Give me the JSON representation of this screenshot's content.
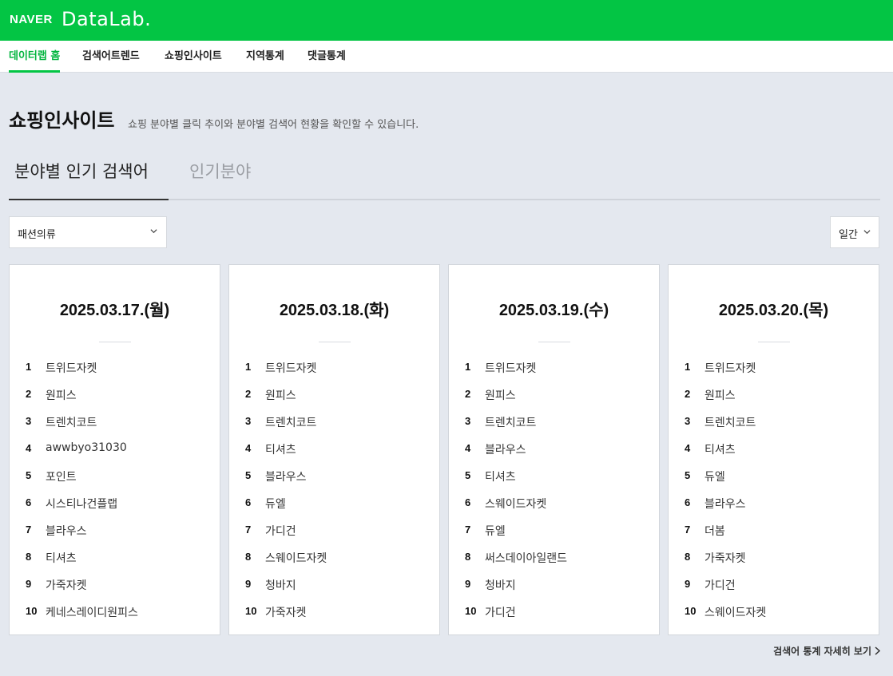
{
  "header": {
    "logo_naver": "NAVER",
    "logo_datalab": "DataLab.",
    "brand_color": "#03c544"
  },
  "nav": {
    "items": [
      {
        "label": "데이터랩 홈",
        "active": true
      },
      {
        "label": "검색어트렌드",
        "active": false
      },
      {
        "label": "쇼핑인사이트",
        "active": false
      },
      {
        "label": "지역통계",
        "active": false
      },
      {
        "label": "댓글통계",
        "active": false
      }
    ]
  },
  "page": {
    "title": "쇼핑인사이트",
    "description": "쇼핑 분야별 클릭 추이와 분야별 검색어 현황을 확인할 수 있습니다."
  },
  "tabs": [
    {
      "label": "분야별 인기 검색어",
      "active": true
    },
    {
      "label": "인기분야",
      "active": false
    }
  ],
  "filters": {
    "category": "패션의류",
    "period": "일간"
  },
  "cards": [
    {
      "date": "2025.03.17.(월)",
      "ranks": [
        {
          "rank": "1",
          "keyword": "트위드자켓"
        },
        {
          "rank": "2",
          "keyword": "원피스"
        },
        {
          "rank": "3",
          "keyword": "트렌치코트"
        },
        {
          "rank": "4",
          "keyword": "awwbyo31030"
        },
        {
          "rank": "5",
          "keyword": "포인트"
        },
        {
          "rank": "6",
          "keyword": "시스티나건플랩"
        },
        {
          "rank": "7",
          "keyword": "블라우스"
        },
        {
          "rank": "8",
          "keyword": "티셔츠"
        },
        {
          "rank": "9",
          "keyword": "가죽자켓"
        },
        {
          "rank": "10",
          "keyword": "케네스레이디원피스"
        }
      ]
    },
    {
      "date": "2025.03.18.(화)",
      "ranks": [
        {
          "rank": "1",
          "keyword": "트위드자켓"
        },
        {
          "rank": "2",
          "keyword": "원피스"
        },
        {
          "rank": "3",
          "keyword": "트렌치코트"
        },
        {
          "rank": "4",
          "keyword": "티셔츠"
        },
        {
          "rank": "5",
          "keyword": "블라우스"
        },
        {
          "rank": "6",
          "keyword": "듀엘"
        },
        {
          "rank": "7",
          "keyword": "가디건"
        },
        {
          "rank": "8",
          "keyword": "스웨이드자켓"
        },
        {
          "rank": "9",
          "keyword": "청바지"
        },
        {
          "rank": "10",
          "keyword": "가죽자켓"
        }
      ]
    },
    {
      "date": "2025.03.19.(수)",
      "ranks": [
        {
          "rank": "1",
          "keyword": "트위드자켓"
        },
        {
          "rank": "2",
          "keyword": "원피스"
        },
        {
          "rank": "3",
          "keyword": "트렌치코트"
        },
        {
          "rank": "4",
          "keyword": "블라우스"
        },
        {
          "rank": "5",
          "keyword": "티셔츠"
        },
        {
          "rank": "6",
          "keyword": "스웨이드자켓"
        },
        {
          "rank": "7",
          "keyword": "듀엘"
        },
        {
          "rank": "8",
          "keyword": "써스데이아일랜드"
        },
        {
          "rank": "9",
          "keyword": "청바지"
        },
        {
          "rank": "10",
          "keyword": "가디건"
        }
      ]
    },
    {
      "date": "2025.03.20.(목)",
      "ranks": [
        {
          "rank": "1",
          "keyword": "트위드자켓"
        },
        {
          "rank": "2",
          "keyword": "원피스"
        },
        {
          "rank": "3",
          "keyword": "트렌치코트"
        },
        {
          "rank": "4",
          "keyword": "티셔츠"
        },
        {
          "rank": "5",
          "keyword": "듀엘"
        },
        {
          "rank": "6",
          "keyword": "블라우스"
        },
        {
          "rank": "7",
          "keyword": "더봄"
        },
        {
          "rank": "8",
          "keyword": "가죽자켓"
        },
        {
          "rank": "9",
          "keyword": "가디건"
        },
        {
          "rank": "10",
          "keyword": "스웨이드자켓"
        }
      ]
    }
  ],
  "footer": {
    "more_link": "검색어 통계 자세히 보기"
  }
}
